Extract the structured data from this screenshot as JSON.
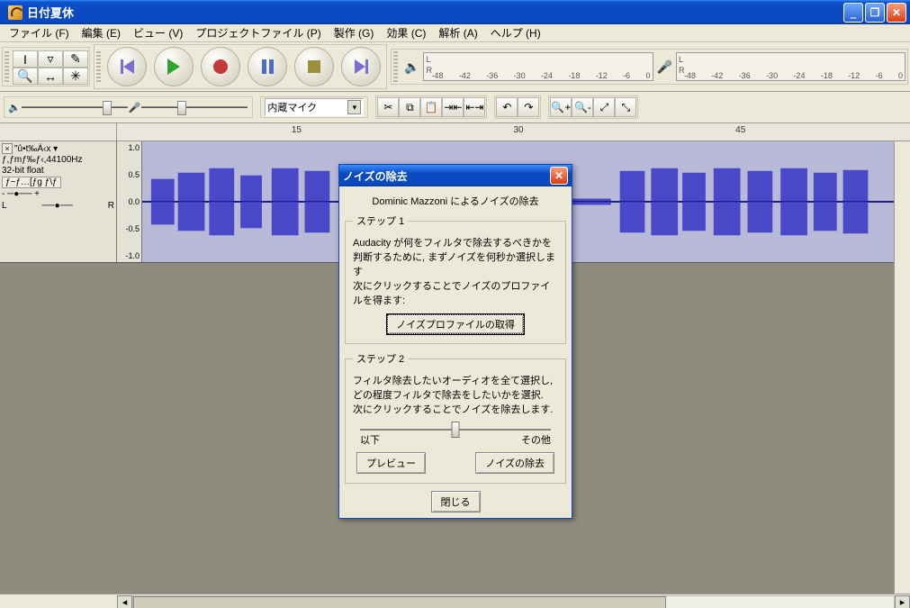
{
  "window": {
    "title": "日付夏休"
  },
  "menu": {
    "items": [
      "ファイル (F)",
      "編集 (E)",
      "ビュー (V)",
      "プロジェクトファイル (P)",
      "製作 (G)",
      "効果 (C)",
      "解析 (A)",
      "ヘルプ (H)"
    ]
  },
  "meter": {
    "L": "L",
    "R": "R",
    "ticks": [
      "-48",
      "-42",
      "-36",
      "-30",
      "-24",
      "-18",
      "-12",
      "-6",
      "0"
    ]
  },
  "device": {
    "selected": "内蔵マイク"
  },
  "ruler": {
    "marks": [
      "15",
      "30",
      "45"
    ]
  },
  "track": {
    "name": "\"û•t‰Ä‹x ▾",
    "rate": "ƒ,ƒmƒ‰ƒ‹,44100Hz",
    "format": "32-bit float",
    "row3": "ƒ~ƒ…[ƒg ƒ\\ƒ",
    "gain": "- ─●── +",
    "panL": "L",
    "panR": "R",
    "scale": [
      "1.0",
      "0.5",
      "0.0",
      "-0.5",
      "-1.0"
    ]
  },
  "dialog": {
    "title": "ノイズの除去",
    "credit": "Dominic Mazzoni によるノイズの除去",
    "step1": {
      "legend": "ステップ 1",
      "text1": "Audacity が何をフィルタで除去するべきかを",
      "text2": "判断するために, まずノイズを何秒か選択します",
      "text3": "次にクリックすることでノイズのプロファイルを得ます:",
      "button": "ノイズプロファイルの取得"
    },
    "step2": {
      "legend": "ステップ 2",
      "text1": "フィルタ除去したいオーディオを全て選択し,",
      "text2": "どの程度フィルタで除去をしたいかを選択.",
      "text3": "次にクリックすることでノイズを除去します.",
      "less": "以下",
      "more": "その他",
      "preview": "プレビュー",
      "remove": "ノイズの除去"
    },
    "close": "閉じる"
  }
}
